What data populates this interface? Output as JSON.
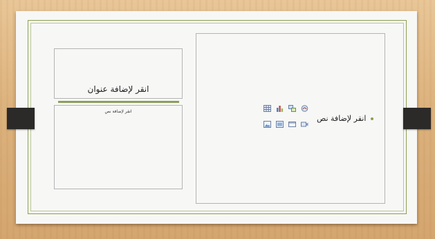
{
  "slide": {
    "title_placeholder": "انقر لإضافة عنوان",
    "text_placeholder_small": "انقر لإضافة نص",
    "content_placeholder": "انقر لإضافة نص"
  },
  "content_icons": [
    "table-icon",
    "chart-icon",
    "smartart-icon",
    "clipart-icon",
    "picture-icon",
    "media-icon",
    "screenshot-icon",
    "video-icon"
  ],
  "colors": {
    "accent_green": "#8aa04f",
    "wood": "#dcb27d",
    "tab_black": "#2b2a28"
  }
}
